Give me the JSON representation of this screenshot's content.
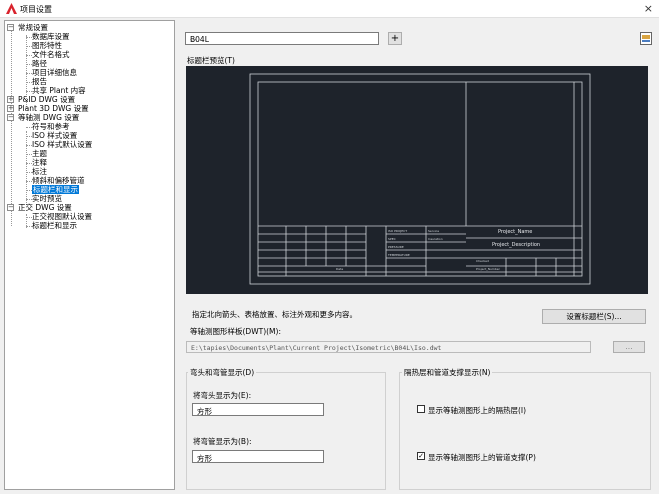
{
  "window": {
    "title": "项目设置",
    "close_glyph": "×"
  },
  "tree": {
    "items": [
      {
        "label": "常规设置",
        "toggle": "−"
      },
      {
        "label": "数据库设置"
      },
      {
        "label": "图形特性"
      },
      {
        "label": "文件名格式"
      },
      {
        "label": "路径"
      },
      {
        "label": "项目详细信息"
      },
      {
        "label": "报告"
      },
      {
        "label": "共享 Plant 内容"
      },
      {
        "label": "P&ID DWG 设置",
        "toggle": "+"
      },
      {
        "label": "Plant 3D DWG 设置",
        "toggle": "+"
      },
      {
        "label": "等轴测 DWG 设置",
        "toggle": "−"
      },
      {
        "label": "符号和参考"
      },
      {
        "label": "ISO 样式设置"
      },
      {
        "label": "ISO 样式默认设置"
      },
      {
        "label": "主题"
      },
      {
        "label": "注释"
      },
      {
        "label": "标注"
      },
      {
        "label": "倾斜和偏移管道"
      },
      {
        "label": "标题栏和显示",
        "selected": true
      },
      {
        "label": "实时预览"
      },
      {
        "label": "正交 DWG 设置",
        "toggle": "−"
      },
      {
        "label": "正交视图默认设置"
      },
      {
        "label": "标题栏和显示"
      }
    ]
  },
  "top": {
    "style_select": "B04L",
    "add_label": "+",
    "help_icon": "help-icon"
  },
  "preview": {
    "label": "标题栏预览(T)",
    "project_name": "Project_Name",
    "project_description": "Project_Description"
  },
  "info": {
    "text": "指定北向箭头、表格放置、标注外观和更多内容。",
    "setup_button": "设置标题栏(S)..."
  },
  "template": {
    "label": "等轴测图形样板(DWT)(M):",
    "path": "E:\\tapies\\Documents\\Plant\\Current Project\\Isometric\\B04L\\Iso.dwt",
    "browse": "..."
  },
  "elbow": {
    "title": "弯头和弯管显示(D)",
    "elbow_label": "将弯头显示为(E):",
    "elbow_value": "方形",
    "bend_label": "将弯管显示为(B):",
    "bend_value": "方形"
  },
  "insulation": {
    "title": "隔热层和管道支撑显示(N)",
    "show_insulation": "显示等轴测图形上的隔热层(I)",
    "show_insulation_checked": false,
    "show_supports": "显示等轴测图形上的管道支撑(P)",
    "show_supports_checked": true
  },
  "colors": {
    "accent": "#0078d7",
    "preview_bg": "#1e232b",
    "app_icon": "#d9232d"
  }
}
